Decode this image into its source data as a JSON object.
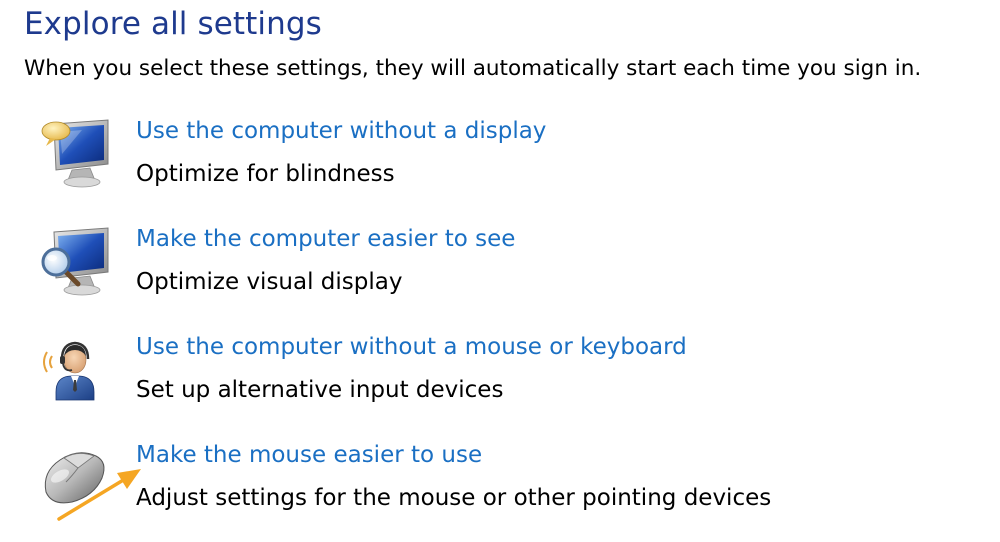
{
  "header": {
    "title": "Explore all settings",
    "subtitle": "When you select these settings, they will automatically start each time you sign in."
  },
  "items": [
    {
      "link": "Use the computer without a display",
      "description": "Optimize for blindness",
      "icon": "monitor-speech-icon"
    },
    {
      "link": "Make the computer easier to see",
      "description": "Optimize visual display",
      "icon": "monitor-magnifier-icon"
    },
    {
      "link": "Use the computer without a mouse or keyboard",
      "description": "Set up alternative input devices",
      "icon": "user-headset-icon"
    },
    {
      "link": "Make the mouse easier to use",
      "description": "Adjust settings for the mouse or other pointing devices",
      "icon": "mouse-icon"
    }
  ],
  "colors": {
    "title": "#1e3a8e",
    "link": "#1a6fc3",
    "arrow": "#f5a623"
  }
}
